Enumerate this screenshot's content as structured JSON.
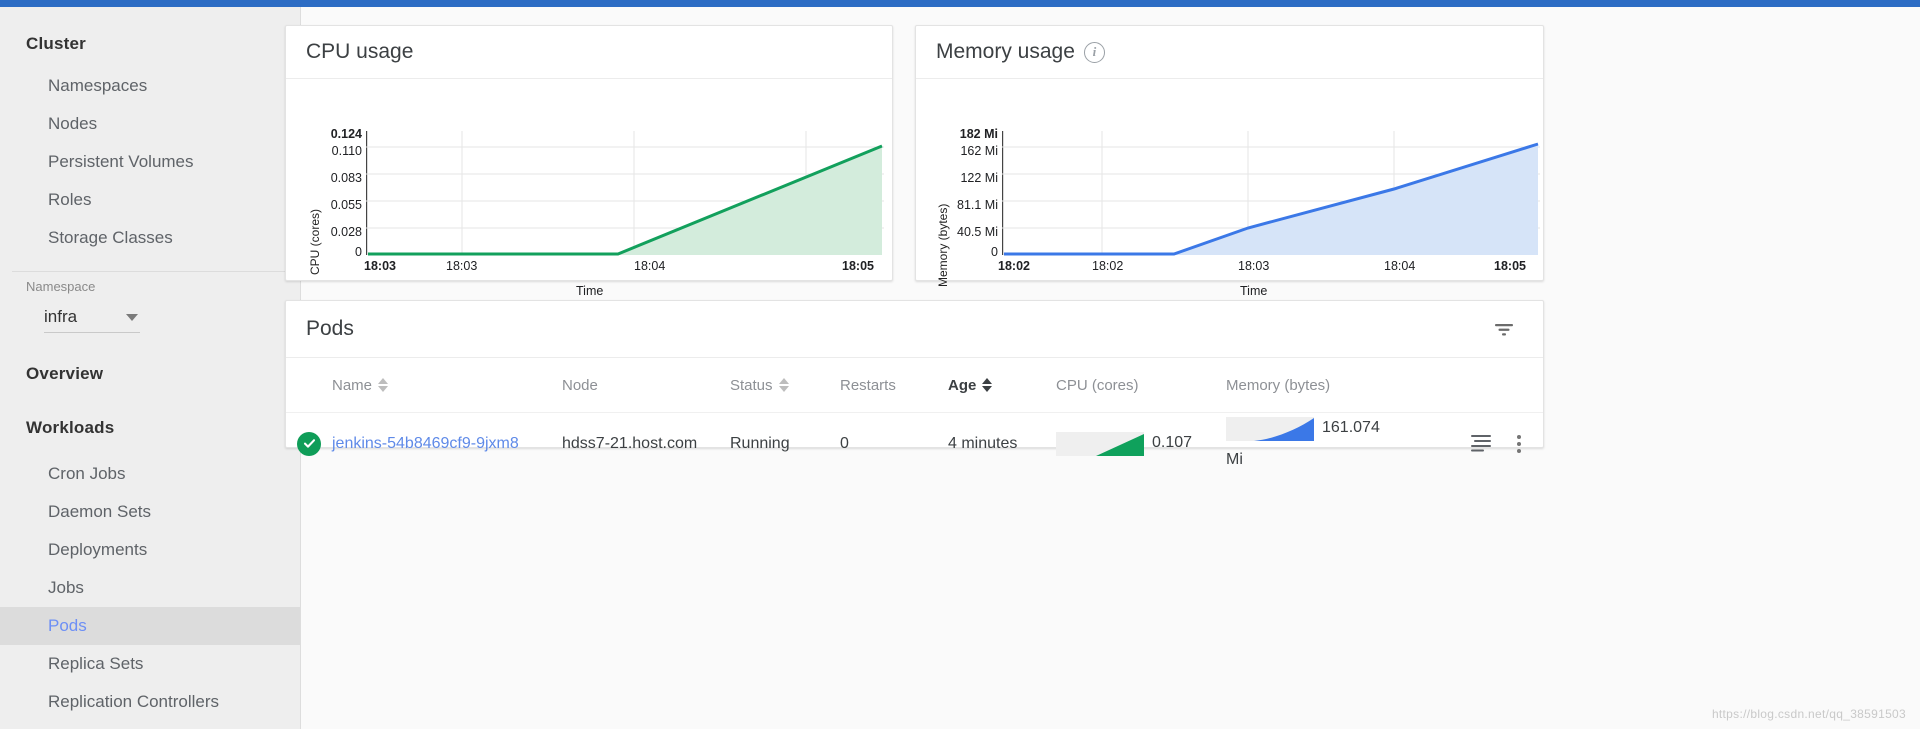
{
  "sidebar": {
    "cluster_header": "Cluster",
    "cluster_items": [
      {
        "label": "Namespaces"
      },
      {
        "label": "Nodes"
      },
      {
        "label": "Persistent Volumes"
      },
      {
        "label": "Roles"
      },
      {
        "label": "Storage Classes"
      }
    ],
    "namespace_label": "Namespace",
    "namespace_value": "infra",
    "overview_header": "Overview",
    "workloads_header": "Workloads",
    "workload_items": [
      {
        "label": "Cron Jobs"
      },
      {
        "label": "Daemon Sets"
      },
      {
        "label": "Deployments"
      },
      {
        "label": "Jobs"
      },
      {
        "label": "Pods"
      },
      {
        "label": "Replica Sets"
      },
      {
        "label": "Replication Controllers"
      }
    ],
    "selected_item": "Pods",
    "selected_color": "#6d8ff5"
  },
  "cards": {
    "cpu_title": "CPU usage",
    "memory_title": "Memory usage",
    "memory_info_icon": "info-icon",
    "pods_title": "Pods",
    "filter_icon": "filter-icon"
  },
  "chart_data": [
    {
      "type": "area",
      "title": "CPU usage",
      "xlabel": "Time",
      "ylabel": "CPU (cores)",
      "ytick_labels": [
        "0.124",
        "0.110",
        "0.083",
        "0.055",
        "0.028",
        "0"
      ],
      "ytick_values": [
        0.124,
        0.11,
        0.083,
        0.055,
        0.028,
        0
      ],
      "ylim": [
        0,
        0.124
      ],
      "xtick_labels": [
        "18:03",
        "18:03",
        "18:04",
        "18:05"
      ],
      "x": [
        "18:03",
        "18:03",
        "18:04",
        "18:05"
      ],
      "values": [
        0,
        0,
        0.055,
        0.11
      ],
      "series": [
        {
          "name": "CPU (cores)",
          "values": [
            0,
            0,
            0,
            0,
            0.055,
            0.11
          ]
        }
      ],
      "points": [
        {
          "t": "18:02:30",
          "v": 0
        },
        {
          "t": "18:03:30",
          "v": 0
        },
        {
          "t": "18:03:40",
          "v": 0
        },
        {
          "t": "18:04:00",
          "v": 0.048
        },
        {
          "t": "18:05:00",
          "v": 0.11
        }
      ],
      "line_color": "#0f9d58",
      "fill_color": "#d3ecdc",
      "grid": true,
      "legend": "none"
    },
    {
      "type": "area",
      "title": "Memory usage",
      "xlabel": "Time",
      "ylabel": "Memory (bytes)",
      "ytick_labels": [
        "182 Mi",
        "162 Mi",
        "122 Mi",
        "81.1 Mi",
        "40.5 Mi",
        "0"
      ],
      "ytick_values": [
        182,
        162,
        122,
        81.1,
        40.5,
        0
      ],
      "ylim": [
        0,
        182
      ],
      "xtick_labels": [
        "18:02",
        "18:02",
        "18:03",
        "18:04",
        "18:05"
      ],
      "x": [
        "18:02",
        "18:02",
        "18:03",
        "18:04",
        "18:05"
      ],
      "values": [
        0,
        0,
        40.5,
        110,
        162
      ],
      "series": [
        {
          "name": "Memory (bytes)",
          "values": [
            0,
            0,
            40.5,
            110,
            162
          ]
        }
      ],
      "points": [
        {
          "t": "18:02:00",
          "v": 0
        },
        {
          "t": "18:02:40",
          "v": 0
        },
        {
          "t": "18:03:00",
          "v": 36
        },
        {
          "t": "18:04:00",
          "v": 106
        },
        {
          "t": "18:05:00",
          "v": 162
        }
      ],
      "line_color": "#3b78e7",
      "fill_color": "#d6e4f8",
      "grid": true,
      "legend": "none"
    }
  ],
  "table": {
    "columns": [
      {
        "label": "Name",
        "sortable": true,
        "active": false
      },
      {
        "label": "Node",
        "sortable": false,
        "active": false
      },
      {
        "label": "Status",
        "sortable": true,
        "active": false
      },
      {
        "label": "Restarts",
        "sortable": false,
        "active": false
      },
      {
        "label": "Age",
        "sortable": true,
        "active": true
      },
      {
        "label": "CPU (cores)",
        "sortable": false,
        "active": false
      },
      {
        "label": "Memory (bytes)",
        "sortable": false,
        "active": false
      }
    ],
    "rows": [
      {
        "status_icon": "check-circle-icon",
        "status_color": "#0f9d58",
        "name": "jenkins-54b8469cf9-9jxm8",
        "node": "hdss7-21.host.com",
        "status": "Running",
        "restarts": "0",
        "age": "4 minutes",
        "cpu_value": "0.107",
        "memory_value": "161.074",
        "memory_unit": "Mi",
        "logs_icon": "logs-icon",
        "menu_icon": "kebab-menu-icon"
      }
    ]
  },
  "watermark": "https://blog.csdn.net/qq_38591503"
}
